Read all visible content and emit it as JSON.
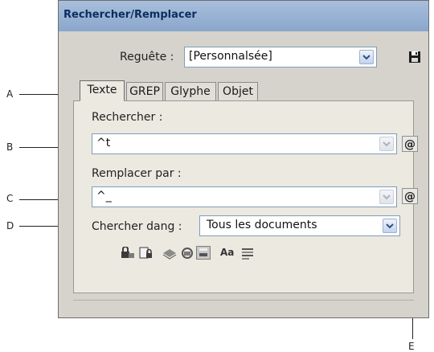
{
  "dialog": {
    "title": "Rechercher/Remplacer",
    "query_label": "Reguête :",
    "query_value": "[Personnalsée]",
    "save_icon": "floppy-disk-icon"
  },
  "tabs": [
    {
      "label": "Texte",
      "active": true
    },
    {
      "label": "GREP",
      "active": false
    },
    {
      "label": "Glyphe",
      "active": false
    },
    {
      "label": "Objet",
      "active": false
    }
  ],
  "find": {
    "label": "Rechercher :",
    "value": "^t",
    "special_chars_icon": "at-symbol-icon"
  },
  "replace": {
    "label": "Remplacer par :",
    "value": "^_",
    "special_chars_icon": "at-symbol-icon"
  },
  "search_in": {
    "label": "Chercher dang :",
    "value": "Tous les documents"
  },
  "options": {
    "icons": [
      "locked-layers-icon",
      "locked-stories-icon",
      "hidden-layers-icon",
      "master-pages-icon",
      "footnotes-icon",
      "case-sensitive-icon",
      "whole-word-icon"
    ],
    "case_label": "Aa"
  },
  "callouts": [
    "A",
    "B",
    "C",
    "D",
    "E"
  ],
  "colors": {
    "title_bar": "#8aa6cb",
    "dialog_bg": "#d6d3cc",
    "field_border": "#7f9db9"
  }
}
